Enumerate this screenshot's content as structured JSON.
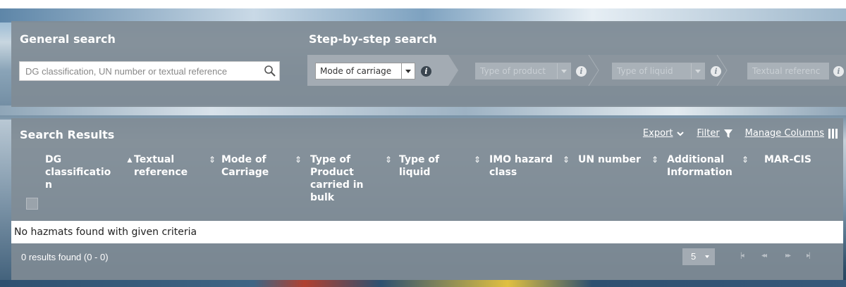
{
  "general_search": {
    "title": "General search",
    "placeholder": "DG classification, UN number or textual reference"
  },
  "step_search": {
    "title": "Step-by-step search",
    "steps": [
      {
        "label": "Mode of carriage",
        "enabled": true
      },
      {
        "label": "Type of product",
        "enabled": false
      },
      {
        "label": "Type of liquid",
        "enabled": false
      },
      {
        "label": "Textual referenc",
        "enabled": false
      }
    ]
  },
  "results": {
    "title": "Search Results",
    "toolbar": {
      "export_label": "Export",
      "filter_label": "Filter",
      "manage_columns_label": "Manage Columns"
    },
    "columns": [
      {
        "line1": "DG",
        "line2": "classificatio",
        "line3": "n",
        "line4": "",
        "sort": "asc"
      },
      {
        "line1": "Textual",
        "line2": "reference",
        "line3": "",
        "line4": "",
        "sort": "both"
      },
      {
        "line1": "Mode of",
        "line2": "Carriage",
        "line3": "",
        "line4": "",
        "sort": "both"
      },
      {
        "line1": "Type of",
        "line2": "Product",
        "line3": "carried in",
        "line4": "bulk",
        "sort": "both"
      },
      {
        "line1": "Type of",
        "line2": "liquid",
        "line3": "",
        "line4": "",
        "sort": "both"
      },
      {
        "line1": "IMO hazard",
        "line2": "class",
        "line3": "",
        "line4": "",
        "sort": "both"
      },
      {
        "line1": "UN number",
        "line2": "",
        "line3": "",
        "line4": "",
        "sort": "both"
      },
      {
        "line1": "Additional",
        "line2": "Information",
        "line3": "",
        "line4": "",
        "sort": "both"
      },
      {
        "line1": "MAR-CIS",
        "line2": "",
        "line3": "",
        "line4": "",
        "sort": "none"
      }
    ],
    "empty_message": "No hazmats found with given criteria",
    "count_text": "0 results found (0 - 0)",
    "page_size": "5"
  },
  "colors": {
    "panel": "#808c96",
    "step_bar": "#8b959e",
    "info_icon": "#3b4650"
  }
}
